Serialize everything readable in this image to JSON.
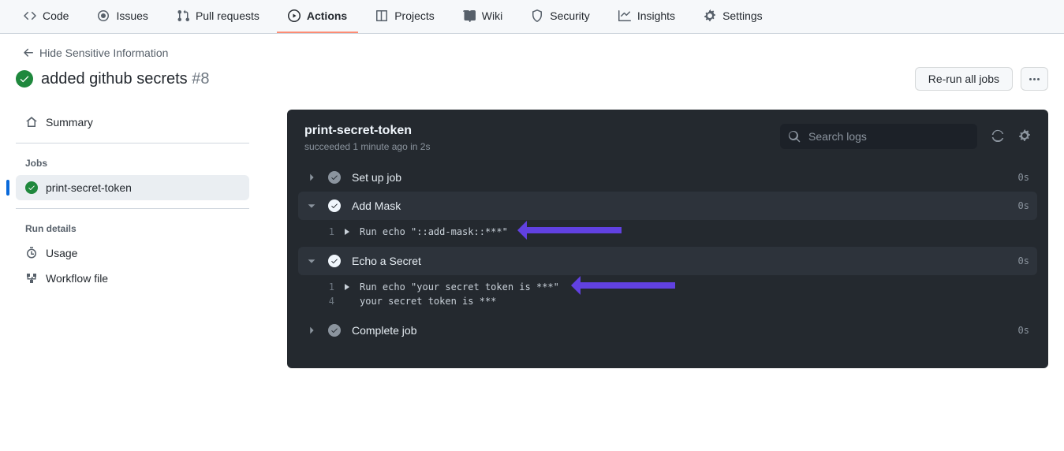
{
  "nav": {
    "code": "Code",
    "issues": "Issues",
    "pulls": "Pull requests",
    "actions": "Actions",
    "projects": "Projects",
    "wiki": "Wiki",
    "security": "Security",
    "insights": "Insights",
    "settings": "Settings"
  },
  "back_link": "Hide Sensitive Information",
  "workflow": {
    "title": "added github secrets",
    "run_number": "#8"
  },
  "actions": {
    "rerun": "Re-run all jobs"
  },
  "sidebar": {
    "summary": "Summary",
    "jobs_heading": "Jobs",
    "run_details_heading": "Run details",
    "job_name": "print-secret-token",
    "usage": "Usage",
    "workflow_file": "Workflow file"
  },
  "job": {
    "name": "print-secret-token",
    "status": "succeeded 1 minute ago in 2s",
    "search_placeholder": "Search logs"
  },
  "steps": {
    "setup": {
      "label": "Set up job",
      "duration": "0s"
    },
    "mask": {
      "label": "Add Mask",
      "duration": "0s",
      "log_ln": "1",
      "log_text": "Run echo \"::add-mask::***\""
    },
    "echo": {
      "label": "Echo a Secret",
      "duration": "0s",
      "log1_ln": "1",
      "log1_text": "Run echo \"your secret token is ***\"",
      "log2_ln": "4",
      "log2_text": "your secret token is ***"
    },
    "complete": {
      "label": "Complete job",
      "duration": "0s"
    }
  }
}
